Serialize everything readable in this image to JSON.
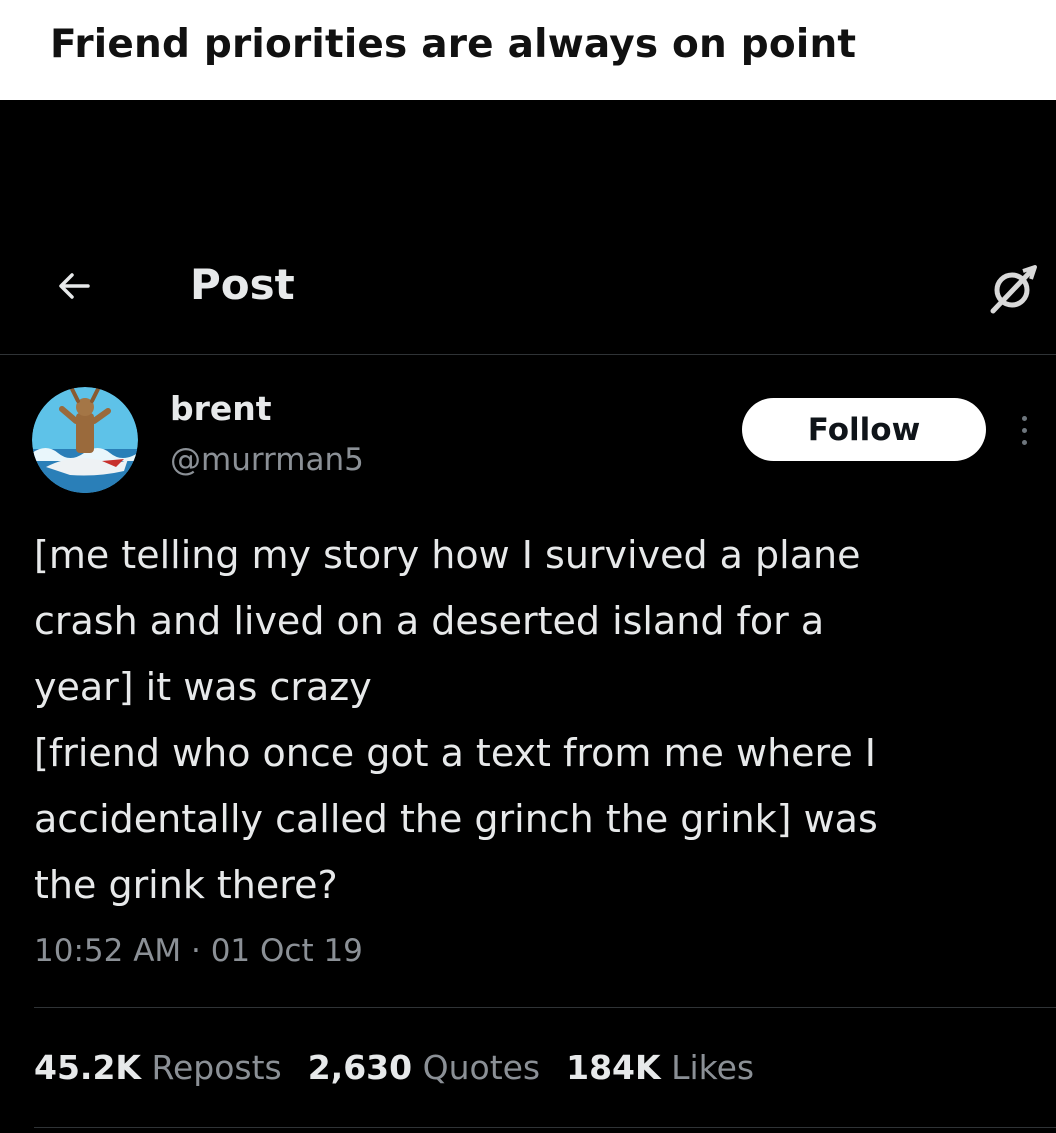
{
  "caption": "Friend priorities are always on point",
  "header": {
    "title": "Post",
    "back_icon": "arrow-left-icon",
    "grok_icon": "grok-icon"
  },
  "author": {
    "name": "brent",
    "handle": "@murrman5",
    "avatar": "avatar-shark-surfer"
  },
  "follow_label": "Follow",
  "tweet": {
    "lines": [
      "[me telling my story how I survived a plane",
      "crash and lived on a deserted island for a",
      "year] it was crazy",
      "[friend who once got a text from me where I",
      "accidentally called the grinch the grink] was",
      "the grink there?"
    ]
  },
  "timestamp": "10:52 AM · 01 Oct 19",
  "stats": {
    "reposts_count": "45.2K",
    "reposts_label": "Reposts",
    "quotes_count": "2,630",
    "quotes_label": "Quotes",
    "likes_count": "184K",
    "likes_label": "Likes"
  },
  "colors": {
    "background": "#000000",
    "text_primary": "#e7e9ea",
    "text_secondary": "#8b9096",
    "divider": "#2f3336",
    "caption_bg": "#ffffff"
  }
}
